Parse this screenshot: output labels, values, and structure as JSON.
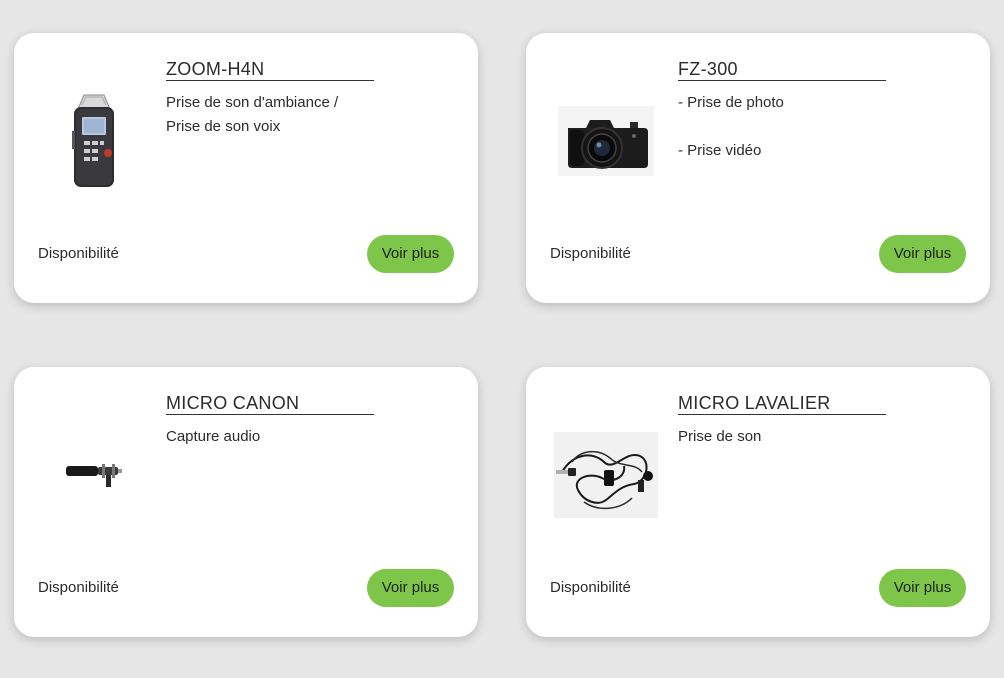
{
  "products": [
    {
      "title": "ZOOM-H4N",
      "desc_lines": [
        "Prise de son d'ambiance /",
        "Prise de son voix"
      ],
      "availability": "Disponibilité",
      "button": "Voir plus",
      "image_icon": "audio-recorder-icon"
    },
    {
      "title": "FZ-300",
      "desc_lines": [
        "- Prise de photo",
        "- Prise vidéo"
      ],
      "availability": "Disponibilité",
      "button": "Voir plus",
      "image_icon": "camera-icon"
    },
    {
      "title": "MICRO CANON",
      "desc_lines": [
        "Capture audio"
      ],
      "availability": "Disponibilité",
      "button": "Voir plus",
      "image_icon": "shotgun-microphone-icon"
    },
    {
      "title": "MICRO LAVALIER",
      "desc_lines": [
        "Prise de son"
      ],
      "availability": "Disponibilité",
      "button": "Voir plus",
      "image_icon": "lavalier-microphone-icon"
    }
  ],
  "colors": {
    "background": "#e6e6e6",
    "card": "#ffffff",
    "button": "#7dc64a",
    "text": "#2b2b2b"
  }
}
